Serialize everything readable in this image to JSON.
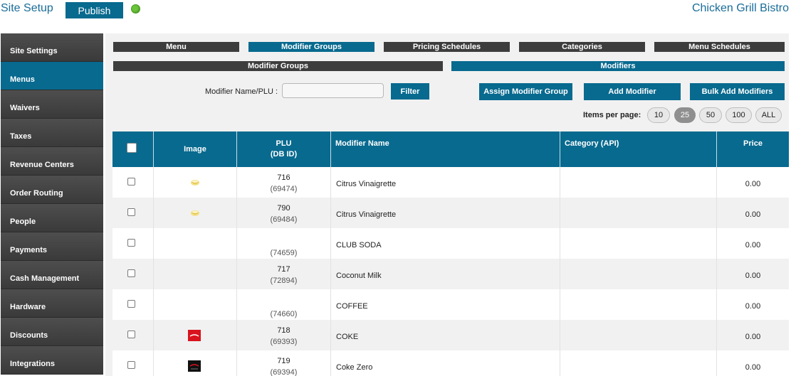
{
  "header": {
    "title": "Site Setup",
    "publish_label": "Publish",
    "restaurant": "Chicken Grill Bistro"
  },
  "sidebar": {
    "items": [
      {
        "label": "Site Settings",
        "active": false
      },
      {
        "label": "Menus",
        "active": true
      },
      {
        "label": "Waivers",
        "active": false
      },
      {
        "label": "Taxes",
        "active": false
      },
      {
        "label": "Revenue Centers",
        "active": false
      },
      {
        "label": "Order Routing",
        "active": false
      },
      {
        "label": "People",
        "active": false
      },
      {
        "label": "Payments",
        "active": false
      },
      {
        "label": "Cash Management",
        "active": false
      },
      {
        "label": "Hardware",
        "active": false
      },
      {
        "label": "Discounts",
        "active": false
      },
      {
        "label": "Integrations",
        "active": false
      }
    ]
  },
  "tabs": [
    {
      "label": "Menu",
      "active": false
    },
    {
      "label": "Modifier Groups",
      "active": true
    },
    {
      "label": "Pricing Schedules",
      "active": false
    },
    {
      "label": "Categories",
      "active": false
    },
    {
      "label": "Menu Schedules",
      "active": false
    }
  ],
  "subtabs": [
    {
      "label": "Modifier Groups",
      "active": false
    },
    {
      "label": "Modifiers",
      "active": true
    }
  ],
  "filter": {
    "label": "Modifier Name/PLU :",
    "value": "",
    "button": "Filter"
  },
  "actions": {
    "assign": "Assign Modifier Group",
    "add": "Add Modifier",
    "bulk": "Bulk Add Modifiers"
  },
  "pagination": {
    "label": "Items per page:",
    "options": [
      "10",
      "25",
      "50",
      "100",
      "ALL"
    ],
    "selected": "25"
  },
  "table": {
    "columns": {
      "image": "Image",
      "plu": "PLU",
      "plu_sub": "(DB ID)",
      "name": "Modifier Name",
      "category": "Category (API)",
      "price": "Price"
    },
    "rows": [
      {
        "plu": "716",
        "db_id": "(69474)",
        "name": "Citrus Vinaigrette",
        "category": "",
        "price": "0.00",
        "image": "dressing-icon"
      },
      {
        "plu": "790",
        "db_id": "(69484)",
        "name": "Citrus Vinaigrette",
        "category": "",
        "price": "0.00",
        "image": "dressing-icon"
      },
      {
        "plu": "",
        "db_id": "(74659)",
        "name": "CLUB SODA",
        "category": "",
        "price": "0.00",
        "image": ""
      },
      {
        "plu": "717",
        "db_id": "(72894)",
        "name": "Coconut Milk",
        "category": "",
        "price": "0.00",
        "image": ""
      },
      {
        "plu": "",
        "db_id": "(74660)",
        "name": "COFFEE",
        "category": "",
        "price": "0.00",
        "image": ""
      },
      {
        "plu": "718",
        "db_id": "(69393)",
        "name": "COKE",
        "category": "",
        "price": "0.00",
        "image": "coke-icon"
      },
      {
        "plu": "719",
        "db_id": "(69394)",
        "name": "Coke Zero",
        "category": "",
        "price": "0.00",
        "image": "coke-zero-icon"
      }
    ]
  },
  "colors": {
    "accent": "#086a8f",
    "sidebar": "#444444",
    "status": "#6bc53a"
  }
}
